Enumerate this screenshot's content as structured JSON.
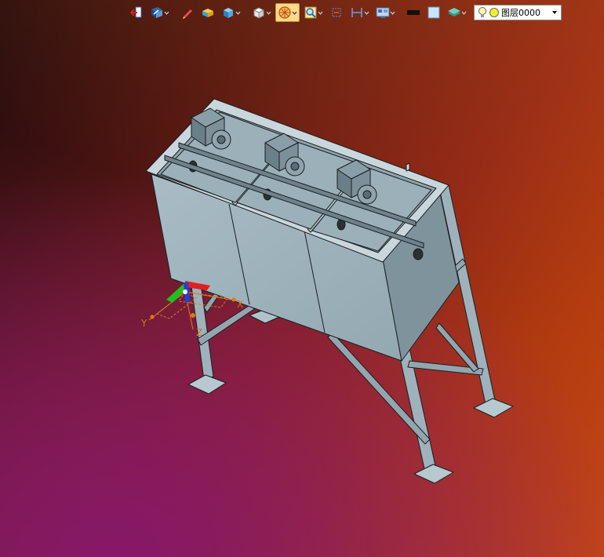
{
  "toolbar": {
    "buttons": [
      {
        "icon": "exit-sketch-icon"
      },
      {
        "icon": "view-orientation-icon",
        "dropdown": true
      },
      {
        "icon": "pencil-icon"
      },
      {
        "icon": "shaded-block-icon"
      },
      {
        "icon": "cube-display-icon",
        "dropdown": true
      },
      {
        "icon": "white-cube-icon",
        "dropdown": true
      },
      {
        "icon": "render-wheel-icon",
        "dropdown": true,
        "active": true
      },
      {
        "icon": "zoom-fit-icon",
        "dropdown": true
      },
      {
        "icon": "rotate-icon"
      },
      {
        "icon": "dimension-icon",
        "dropdown": true
      },
      {
        "icon": "display-settings-icon",
        "dropdown": true
      },
      {
        "icon": "black-rectangle-icon"
      },
      {
        "icon": "light-blue-square-icon"
      },
      {
        "icon": "layers-icon",
        "dropdown": true
      }
    ],
    "layer_value": "图层0000"
  },
  "triad": {
    "x_label": "X",
    "y_label": "Y",
    "z_label": "Z"
  },
  "colors": {
    "model_face": "#9fb2bb",
    "model_face_dark": "#7f939c",
    "model_edge": "#1a1f22",
    "axis_x": "#e02020",
    "axis_y": "#20c020",
    "axis_z": "#2040e0",
    "axis_line": "#d08020"
  }
}
